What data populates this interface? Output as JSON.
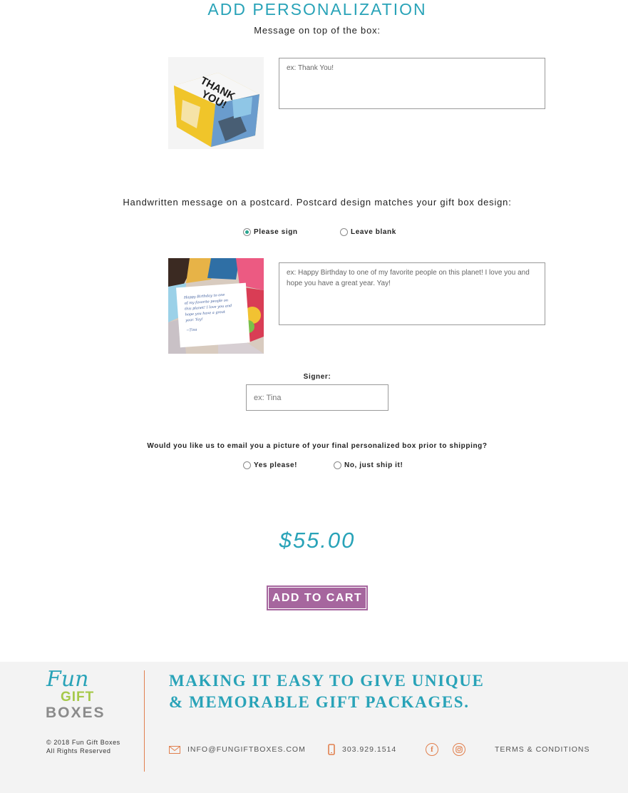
{
  "section_title": "ADD PERSONALIZATION",
  "box_message": {
    "label": "Message on top of the box:",
    "placeholder": "ex: Thank You!",
    "image_text": "THANK YOU!"
  },
  "postcard": {
    "label": "Handwritten message on a postcard. Postcard design matches your gift box design:",
    "options": [
      {
        "label": "Please sign",
        "checked": true
      },
      {
        "label": "Leave blank",
        "checked": false
      }
    ],
    "placeholder": "ex: Happy Birthday to one of my favorite people on this planet! I love you and hope you have a great year. Yay!",
    "image_handwriting": "Happy Birthday to one of my favorite people on this planet! I love you and hope you have a great year. Yay!",
    "image_signature": "~Tina"
  },
  "signer": {
    "label": "Signer:",
    "placeholder": "ex: Tina"
  },
  "email_preview": {
    "question": "Would you like us to email you a picture of your final personalized box prior to shipping?",
    "options": [
      {
        "label": "Yes please!",
        "checked": false
      },
      {
        "label": "No, just ship it!",
        "checked": false
      }
    ]
  },
  "price": "$55.00",
  "add_to_cart_label": "ADD TO CART",
  "footer": {
    "logo": {
      "line1": "Fun",
      "line2": "GIFT",
      "line3": "BOXES"
    },
    "tagline_line1": "MAKING IT EASY TO GIVE UNIQUE",
    "tagline_line2": "& MEMORABLE GIFT PACKAGES.",
    "copyright_line1": "© 2018 Fun Gift Boxes",
    "copyright_line2": "All Rights Reserved",
    "email": "INFO@FUNGIFTBOXES.COM",
    "phone": "303.929.1514",
    "terms": "TERMS & CONDITIONS",
    "social": [
      "facebook-icon",
      "instagram-icon"
    ]
  },
  "colors": {
    "accent_teal": "#29a3b8",
    "button_purple": "#a6669e",
    "footer_orange": "#e1804e",
    "footer_bg": "#f3f3f3"
  }
}
